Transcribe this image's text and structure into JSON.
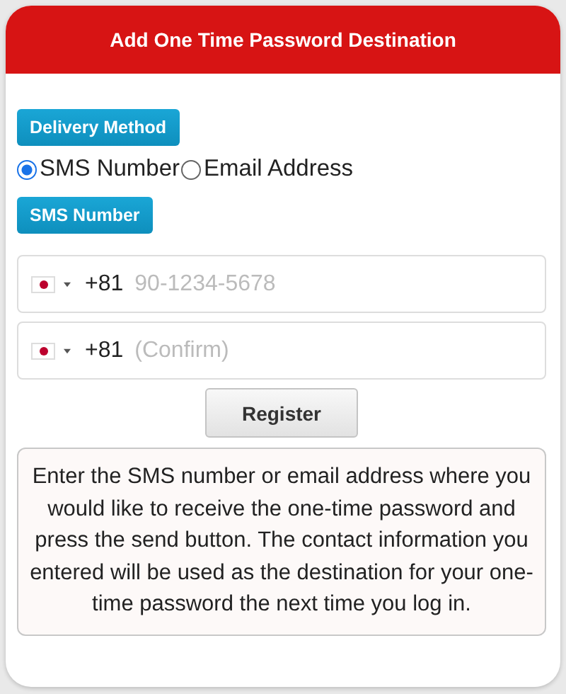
{
  "dialog": {
    "title": "Add One Time Password Destination"
  },
  "delivery_method": {
    "label": "Delivery Method",
    "options": [
      {
        "label": "SMS Number",
        "selected": true
      },
      {
        "label": "Email Address",
        "selected": false
      }
    ]
  },
  "sms_section": {
    "label": "SMS Number"
  },
  "phone_fields": [
    {
      "dial_code": "+81",
      "placeholder": "90-1234-5678"
    },
    {
      "dial_code": "+81",
      "placeholder": "(Confirm)"
    }
  ],
  "register_button": "Register",
  "info": "Enter the SMS number or email address where you would like to receive the one-time password and press the send button. The contact information you entered will be used as the destination for your one-time password the next time you log in."
}
